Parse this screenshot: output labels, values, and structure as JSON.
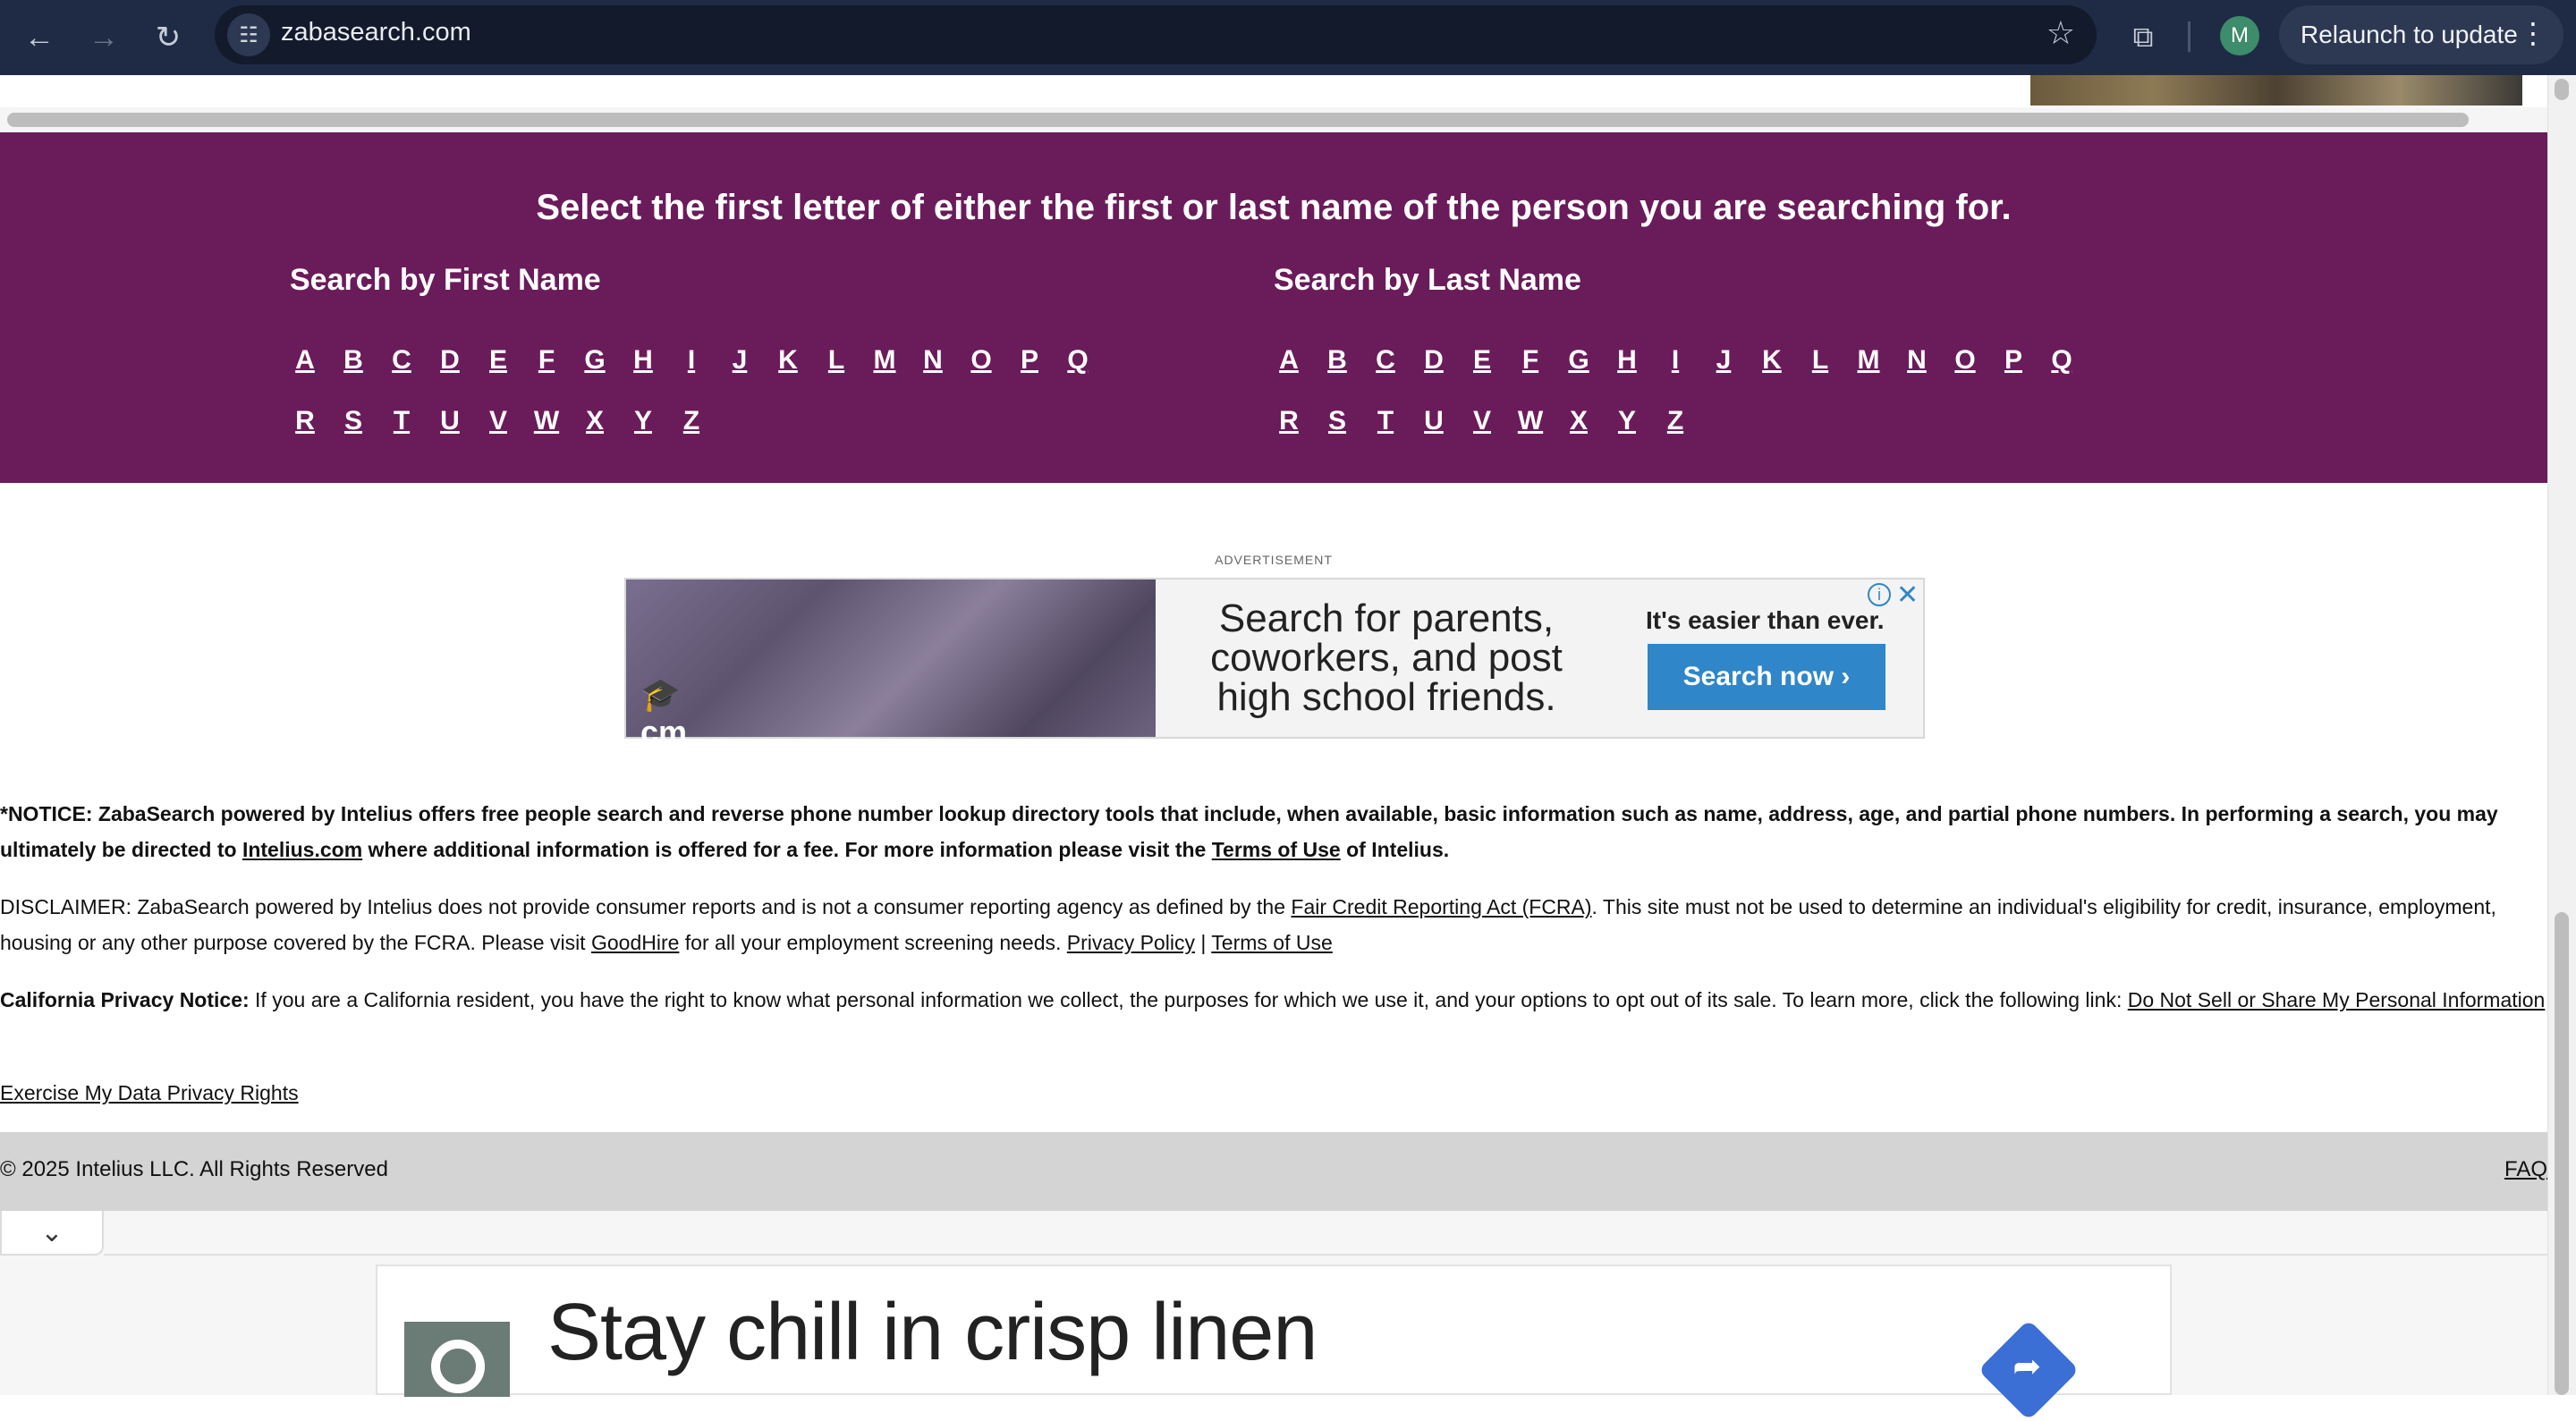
{
  "browser": {
    "url": "zabasearch.com",
    "relaunch_label": "Relaunch to update",
    "avatar_letter": "M"
  },
  "search": {
    "headline": "Select the first letter of either the first or last name of the person you are searching for.",
    "first_name_title": "Search by First Name",
    "last_name_title": "Search by Last Name",
    "row1": [
      "A",
      "B",
      "C",
      "D",
      "E",
      "F",
      "G",
      "H",
      "I",
      "J",
      "K",
      "L",
      "M",
      "N",
      "O",
      "P",
      "Q"
    ],
    "row2": [
      "R",
      "S",
      "T",
      "U",
      "V",
      "W",
      "X",
      "Y",
      "Z"
    ]
  },
  "ad": {
    "label": "ADVERTISEMENT",
    "logo_text": "cm",
    "headline_lines": [
      "Search for parents,",
      "coworkers, and post",
      "high school friends."
    ],
    "side_title": "It's easier than ever.",
    "cta": "Search now ›"
  },
  "notices": {
    "notice_prefix": "*NOTICE: ZabaSearch powered by Intelius offers free people search and reverse phone number lookup directory tools that include, when available, basic information such as name, address, age, and partial phone numbers. In performing a search, you may ultimately be directed to ",
    "notice_link_intelius": "Intelius.com",
    "notice_middle": " where additional information is offered for a fee. For more information please visit the ",
    "notice_link_terms": "Terms of Use",
    "notice_suffix": " of Intelius.",
    "disclaimer_prefix": "DISCLAIMER: ZabaSearch powered by Intelius does not provide consumer reports and is not a consumer reporting agency as defined by the ",
    "disclaimer_link_fcra": "Fair Credit Reporting Act (FCRA)",
    "disclaimer_middle": ". This site must not be used to determine an individual's eligibility for credit, insurance, employment, housing or any other purpose covered by the FCRA. Please visit ",
    "disclaimer_link_goodhire": "GoodHire",
    "disclaimer_middle2": " for all your employment screening needs. ",
    "disclaimer_link_privacy": "Privacy Policy",
    "disclaimer_sep": " | ",
    "disclaimer_link_terms": "Terms of Use",
    "ca_title": "California Privacy Notice:",
    "ca_text": " If you are a California resident, you have the right to know what personal information we collect, the purposes for which we use it, and your options to opt out of its sale. To learn more, click the following link: ",
    "ca_link": "Do Not Sell or Share My Personal Information",
    "exercise_link": "Exercise My Data Privacy Rights"
  },
  "footer": {
    "copyright": "© 2025 Intelius LLC. All Rights Reserved",
    "faq": "FAQ"
  },
  "sticky_ad": {
    "headline": "Stay chill in crisp linen"
  }
}
